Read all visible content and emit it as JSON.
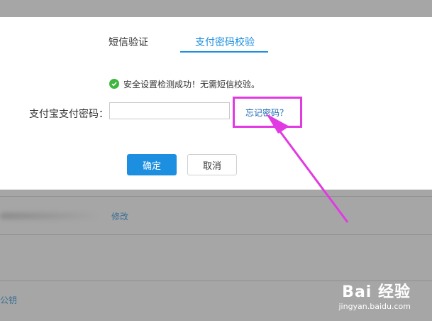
{
  "modal": {
    "tabs": [
      {
        "label": "短信验证"
      },
      {
        "label": "支付密码校验"
      }
    ],
    "notice": "安全设置检测成功！无需短信校验。",
    "password_label": "支付宝支付密码：",
    "password_value": "",
    "forgot_link": "忘记密码？",
    "confirm_label": "确定",
    "cancel_label": "取消"
  },
  "background": {
    "modify_link": "修改",
    "key_link": "公钥"
  },
  "watermark": {
    "main": "Bai 经验",
    "sub": "jingyan.baidu.com"
  },
  "colors": {
    "accent": "#1c8fe0",
    "highlight": "#e23ae2",
    "success": "#3fb63f"
  }
}
